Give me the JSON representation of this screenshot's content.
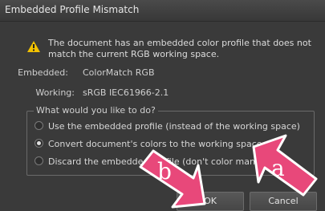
{
  "dialog": {
    "title": "Embedded Profile Mismatch",
    "message": "The document has an embedded color profile that does not match the current RGB working space.",
    "embedded_label": "Embedded:",
    "embedded_value": "ColorMatch RGB",
    "working_label": "Working:",
    "working_value": "sRGB IEC61966-2.1",
    "group_title": "What would you like to do?",
    "options": [
      {
        "label": "Use the embedded profile (instead of the working space)",
        "selected": false
      },
      {
        "label": "Convert document's colors to the working space.",
        "selected": true
      },
      {
        "label": "Discard the embedded profile (don't color manage)",
        "selected": false
      }
    ],
    "ok_label": "OK",
    "cancel_label": "Cancel"
  },
  "annotations": {
    "a_label": "a",
    "b_label": "b",
    "color": "#e8487a"
  },
  "colors": {
    "dialog_bg": "#3a3a3a",
    "warning": "#f2c200"
  }
}
